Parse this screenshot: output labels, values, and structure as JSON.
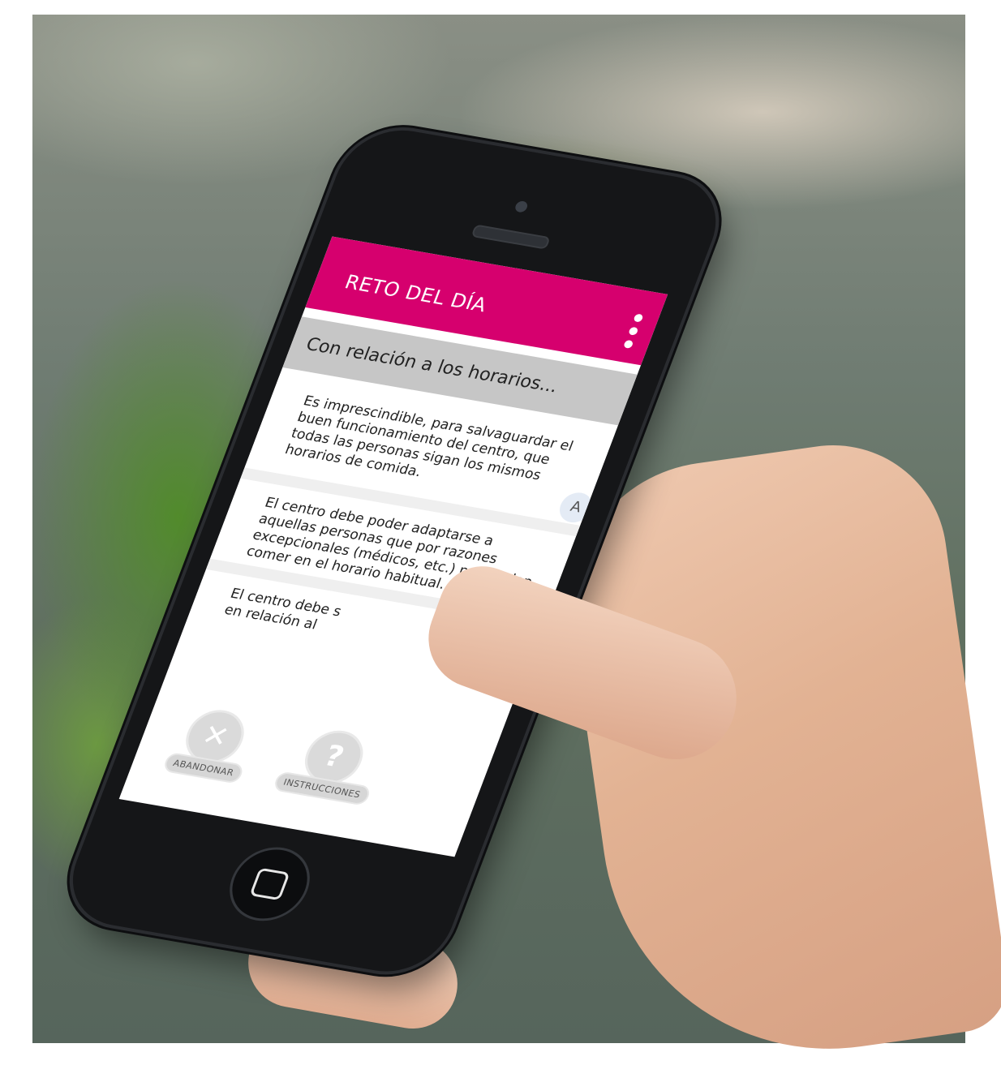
{
  "app": {
    "title": "RETO DEL DÍA",
    "menu_icon": "more-vert-icon",
    "accent_color": "#d6006e"
  },
  "question": {
    "text": "Con relación a los horarios..."
  },
  "answers": [
    {
      "text": "Es imprescindible, para salvaguardar el buen funcionamiento del centro, que todas las personas sigan los mismos horarios de comida.",
      "letter": "A"
    },
    {
      "text": "El centro debe poder adaptarse a aquellas personas que por razones excepcionales (médicos, etc.) no puedan comer en el horario habitual.",
      "letter": ""
    },
    {
      "text": "El centro debe s",
      "text_line2": "en relación al"
    }
  ],
  "actions": {
    "abandon": {
      "label": "ABANDONAR",
      "icon": "close-icon",
      "glyph": "✕"
    },
    "instructions": {
      "label": "INSTRUCCIONES",
      "icon": "help-icon",
      "glyph": "?"
    }
  }
}
